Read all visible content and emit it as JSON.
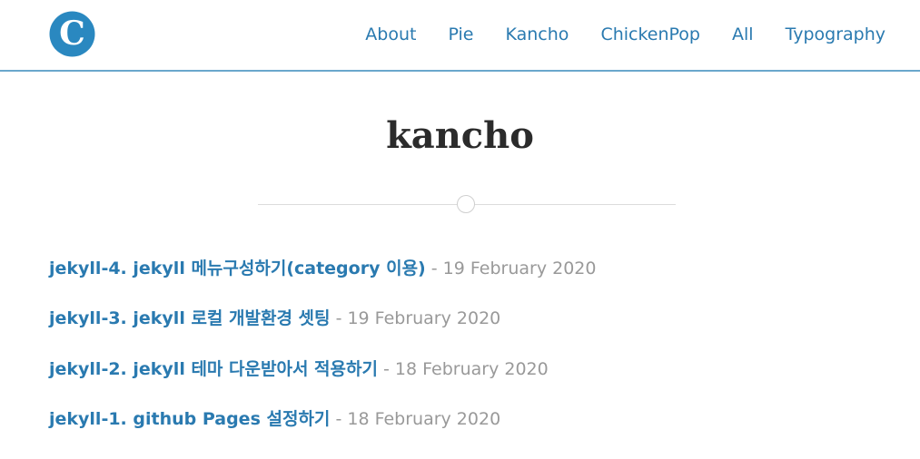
{
  "header": {
    "logo_letter": "C",
    "brand_color": "#2a88c0",
    "nav": [
      {
        "label": "About"
      },
      {
        "label": "Pie"
      },
      {
        "label": "Kancho"
      },
      {
        "label": "ChickenPop"
      },
      {
        "label": "All"
      },
      {
        "label": "Typography"
      }
    ]
  },
  "main": {
    "title": "kancho",
    "posts": [
      {
        "title": "jekyll-4. jekyll 메뉴구성하기(category 이용)",
        "date": "- 19 February 2020"
      },
      {
        "title": "jekyll-3. jekyll 로컬 개발환경 셋팅",
        "date": "- 19 February 2020"
      },
      {
        "title": "jekyll-2. jekyll 테마 다운받아서 적용하기",
        "date": "- 18 February 2020"
      },
      {
        "title": "jekyll-1. github Pages 설정하기",
        "date": "- 18 February 2020"
      }
    ]
  },
  "colors": {
    "link": "#2a7ab0",
    "header_border": "#6aa7cc",
    "date": "#999999",
    "title": "#2b2b2b"
  }
}
